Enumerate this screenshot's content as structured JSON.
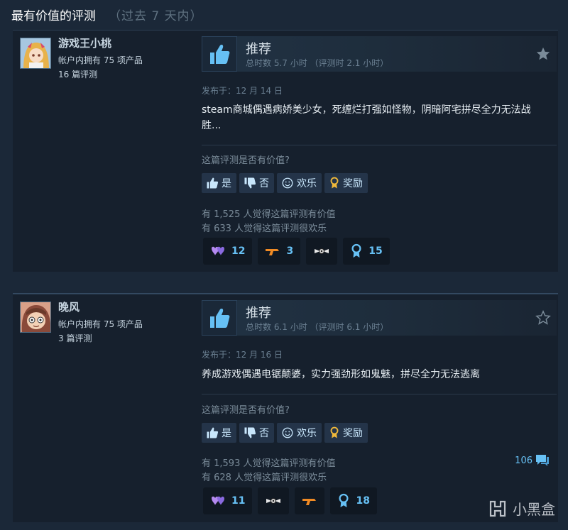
{
  "header": {
    "title": "最有价值的评测",
    "subtitle": "（过去 7 天内）"
  },
  "reviews": [
    {
      "author": "游戏王小桃",
      "products_owned": "帐户内拥有 75 项产品",
      "review_count": "16 篇评测",
      "verdict": "推荐",
      "hours": "总时数 5.7 小时  （评测时 2.1 小时）",
      "posted": "发布于：12 月 14 日",
      "text": "steam商城偶遇病娇美少女，死缠烂打强如怪物，阴暗阿宅拼尽全力无法战胜...",
      "helpful_question": "这篇评测是否有价值?",
      "buttons": {
        "yes": "是",
        "no": "否",
        "funny": "欢乐",
        "award": "奖励"
      },
      "helpful_count": "有 1,525 人觉得这篇评测有价值",
      "funny_count": "有 633 人觉得这篇评测很欢乐",
      "awards": {
        "a1": "12",
        "a2": "3",
        "a4": "15"
      },
      "starred": true
    },
    {
      "author": "晚风",
      "products_owned": "帐户内拥有 75 项产品",
      "review_count": "3 篇评测",
      "verdict": "推荐",
      "hours": "总时数 6.1 小时  （评测时 6.1 小时）",
      "posted": "发布于：12 月 16 日",
      "text": "养成游戏偶遇电锯颠婆，实力强劲形如鬼魅，拼尽全力无法逃离",
      "helpful_question": "这篇评测是否有价值?",
      "buttons": {
        "yes": "是",
        "no": "否",
        "funny": "欢乐",
        "award": "奖励"
      },
      "helpful_count": "有 1,593 人觉得这篇评测有价值",
      "funny_count": "有 628 人觉得这篇评测很欢乐",
      "comment_count": "106",
      "awards": {
        "a1": "11",
        "a4": "18"
      },
      "starred": false
    }
  ],
  "watermark": "小黑盒",
  "colors": {
    "background": "#1b2838",
    "card": "#16202d",
    "accent": "#67c1f5"
  }
}
